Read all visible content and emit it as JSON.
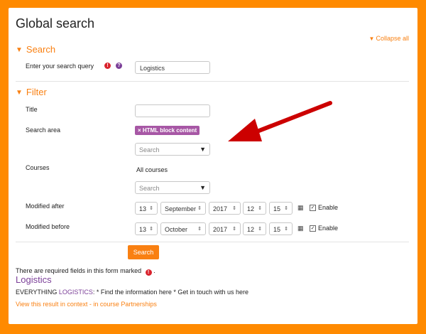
{
  "page": {
    "title": "Global search",
    "collapse_all": "Collapse all"
  },
  "search_section": {
    "heading": "Search",
    "query_label": "Enter your search query",
    "required_glyph": "!",
    "help_glyph": "?",
    "query_value": "Logistics"
  },
  "filter_section": {
    "heading": "Filter",
    "title_label": "Title",
    "title_value": "",
    "search_area_label": "Search area",
    "search_area_tag": "× HTML block content",
    "search_area_placeholder": "Search",
    "courses_label": "Courses",
    "courses_value": "All courses",
    "courses_placeholder": "Search",
    "modified_after": {
      "label": "Modified after",
      "day": "13",
      "month": "September",
      "year": "2017",
      "hour": "12",
      "minute": "15",
      "enable_label": "Enable",
      "enabled": true
    },
    "modified_before": {
      "label": "Modified before",
      "day": "13",
      "month": "October",
      "year": "2017",
      "hour": "12",
      "minute": "15",
      "enable_label": "Enable",
      "enabled": true
    }
  },
  "actions": {
    "search_button": "Search"
  },
  "footnote": {
    "text": "There are required fields in this form marked",
    "end": "."
  },
  "result": {
    "title": "Logistics",
    "text_prefix": "EVERYTHING ",
    "text_highlight": "LOGISTICS",
    "text_suffix": ": * Find the information here * Get in touch with us here",
    "link_context": "View this result in context",
    "link_separator": " - ",
    "link_course": "in course Partnerships"
  },
  "colors": {
    "accent": "#f98012",
    "brand": "#7b3f98",
    "tag": "#a757a5",
    "required": "#d9232d",
    "arrow": "#cc0000"
  },
  "icons": {
    "caret": "▾",
    "updown": "⇕",
    "calendar": "calendar-icon"
  }
}
